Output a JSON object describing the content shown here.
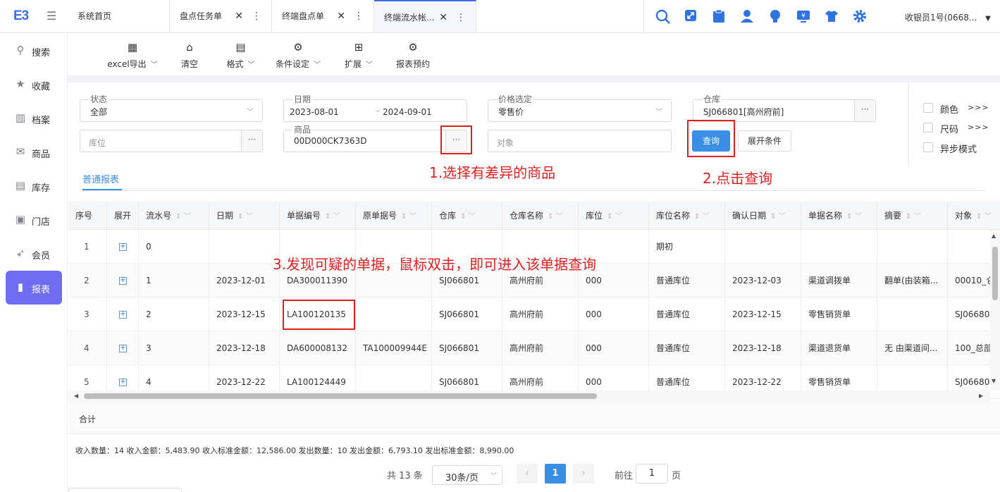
{
  "app": {
    "logo": "E3",
    "user": "收银员1号(0668..."
  },
  "tabs": [
    {
      "label": "系统首页",
      "closable": false
    },
    {
      "label": "盘点任务单",
      "closable": true
    },
    {
      "label": "终端盘点单",
      "closable": true
    },
    {
      "label": "终端流水帐...",
      "closable": true,
      "active": true
    }
  ],
  "header_icons": [
    "search-icon",
    "expand-icon",
    "clipboard-icon",
    "user-icon",
    "bulb-icon",
    "monitor-icon",
    "shirt-icon",
    "gear-icon"
  ],
  "sidebar": {
    "items": [
      {
        "label": "搜索",
        "icon": "search-icon"
      },
      {
        "label": "收藏",
        "icon": "star-icon"
      },
      {
        "label": "档案",
        "icon": "books-icon"
      },
      {
        "label": "商品",
        "icon": "mail-icon"
      },
      {
        "label": "库存",
        "icon": "inbox-icon"
      },
      {
        "label": "门店",
        "icon": "store-icon"
      },
      {
        "label": "会员",
        "icon": "rocket-icon"
      },
      {
        "label": "报表",
        "icon": "chart-icon",
        "active": true
      }
    ]
  },
  "toolbar": {
    "items": [
      {
        "label": "excel导出",
        "dropdown": true,
        "icon": "grid-icon"
      },
      {
        "label": "清空",
        "dropdown": false,
        "icon": "basket-icon"
      },
      {
        "label": "格式",
        "dropdown": true,
        "icon": "format-icon"
      },
      {
        "label": "条件设定",
        "dropdown": true,
        "icon": "gear-icon"
      },
      {
        "label": "扩展",
        "dropdown": true,
        "icon": "apps-icon"
      },
      {
        "label": "报表预约",
        "dropdown": false,
        "icon": "gear-icon"
      }
    ]
  },
  "filters": {
    "status": {
      "label": "状态",
      "value": "全部"
    },
    "date": {
      "label": "日期",
      "start": "2023-08-01",
      "end": "2024-09-01"
    },
    "price": {
      "label": "价格选定",
      "value": "零售价"
    },
    "warehouse": {
      "label": "仓库",
      "value": "SJ066801[高州府前]"
    },
    "location": {
      "placeholder": "库位"
    },
    "product": {
      "label": "商品",
      "value": "00D000CK7363D"
    },
    "target": {
      "placeholder": "对象"
    },
    "query_button": "查询",
    "expand_button": "展开条件",
    "options": [
      {
        "label": "颜色",
        "more": ">>>"
      },
      {
        "label": "尺码",
        "more": ">>>"
      },
      {
        "label": "异步模式"
      }
    ]
  },
  "annotations": {
    "step1": "1.选择有差异的商品",
    "step2": "2.点击查询",
    "step3": "3.发现可疑的单据，鼠标双击，即可进入该单据查询"
  },
  "report_tab": "普通报表",
  "table": {
    "columns": [
      "序号",
      "展开",
      "流水号",
      "日期",
      "单据编号",
      "原单据号",
      "仓库",
      "仓库名称",
      "库位",
      "库位名称",
      "确认日期",
      "单据名称",
      "摘要",
      "对象"
    ],
    "rows": [
      [
        "1",
        "+",
        "0",
        "",
        "",
        "",
        "",
        "",
        "",
        "期初",
        "",
        "",
        "",
        ""
      ],
      [
        "2",
        "+",
        "1",
        "2023-12-01",
        "DA300011390",
        "",
        "SJ066801",
        "高州府前",
        "000",
        "普通库位",
        "2023-12-03",
        "渠道调拨单",
        "翻单(由装箱...",
        "00010_仑"
      ],
      [
        "3",
        "+",
        "2",
        "2023-12-15",
        "LA100120135",
        "",
        "SJ066801",
        "高州府前",
        "000",
        "普通库位",
        "2023-12-15",
        "零售销货单",
        "",
        "SJ06680"
      ],
      [
        "4",
        "+",
        "3",
        "2023-12-18",
        "DA600008132",
        "TA100009944E",
        "SJ066801",
        "高州府前",
        "000",
        "普通库位",
        "2023-12-18",
        "渠道退货单",
        "无 由渠道间...",
        "100_总部"
      ],
      [
        "5",
        "+",
        "4",
        "2023-12-22",
        "LA100124449",
        "",
        "SJ066801",
        "高州府前",
        "000",
        "普通库位",
        "2023-12-22",
        "零售销货单",
        "",
        "SJ06680"
      ]
    ],
    "total_label": "合计"
  },
  "summary": "收入数量：14 收入金额：5,483.90 收入标准金额：12,586.00 发出数量：10 发出金额：6,793.10 发出标准金额：8,990.00",
  "pager": {
    "total": "共 13 条",
    "page_size": "30条/页",
    "current": "1",
    "goto_label": "前往",
    "goto_value": "1",
    "page_unit": "页"
  }
}
